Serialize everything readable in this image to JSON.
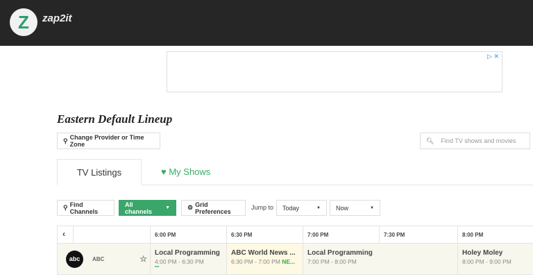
{
  "header": {
    "brand": "zap2it",
    "logo_letter": "Z"
  },
  "ad": {
    "icons": "▷ ✕"
  },
  "page": {
    "title": "Eastern Default Lineup",
    "change_provider": "Change Provider or Time Zone",
    "search_placeholder": "Find TV shows and movies"
  },
  "tabs": [
    {
      "label": "TV Listings"
    },
    {
      "label": "My Shows"
    }
  ],
  "toolbar": {
    "find_channels": "Find Channels",
    "all_channels": "All channels",
    "grid_prefs": "Grid Preferences",
    "jump_to": "Jump to",
    "day": "Today",
    "time": "Now"
  },
  "grid": {
    "times": [
      "6:00 PM",
      "6:30 PM",
      "7:00 PM",
      "7:30 PM",
      "8:00 PM"
    ],
    "channel": {
      "logo": "abc",
      "name": "ABC"
    },
    "programs": [
      {
        "title": "Local Programming",
        "time": "4:00 PM - 6:30 PM",
        "more": "•••"
      },
      {
        "title": "ABC World News ...",
        "time": "6:30 PM - 7:00 PM",
        "badge": "NE..."
      },
      {
        "title": "Local Programming",
        "time": "7:00 PM - 8:00 PM"
      },
      {
        "title": "Holey Moley",
        "time": "8:00 PM - 9:00 PM"
      }
    ]
  }
}
